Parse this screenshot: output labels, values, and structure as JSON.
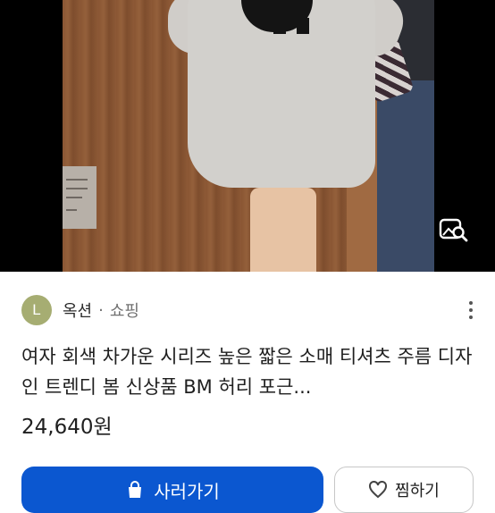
{
  "product_image": {
    "alt_icon": "image-search-icon"
  },
  "source": {
    "avatar_letter": "L",
    "name": "옥션",
    "separator": "·",
    "category": "쇼핑",
    "avatar_color": "#a6ad72"
  },
  "product": {
    "title": "여자 회색 차가운 시리즈 높은 짧은 소매 티셔츠 주름 디자인 트렌디 봄 신상품 BM 허리 포근...",
    "price": "24,640원"
  },
  "actions": {
    "cart_label": "사러가기",
    "save_label": "찜하기",
    "cart_color": "#0b57d0"
  }
}
